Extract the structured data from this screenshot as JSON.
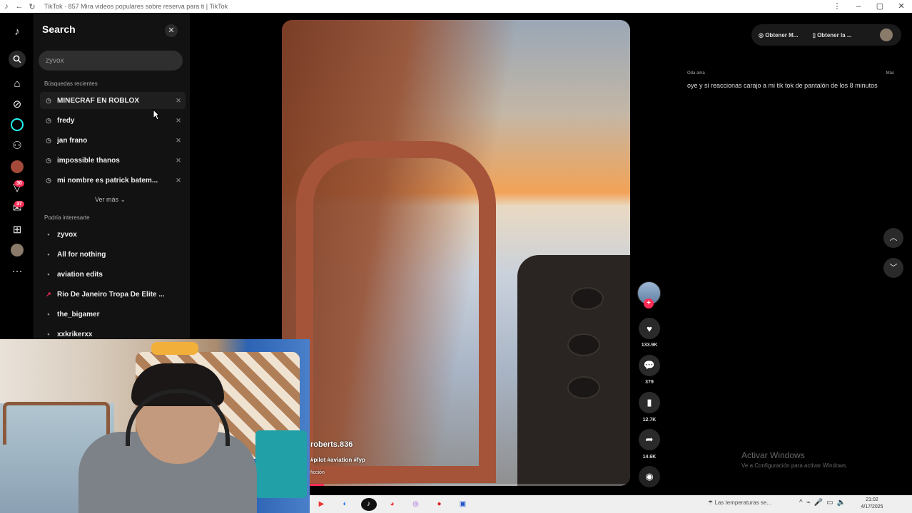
{
  "browser": {
    "tab_title": "TikTok · 857 Mira videos populares sobre reserva para ti | TikTok",
    "window_controls": [
      "⋮",
      "–",
      "▢",
      "✕"
    ]
  },
  "rail": {
    "badges": {
      "activity": "30",
      "messages": "37"
    }
  },
  "search_panel": {
    "title": "Search",
    "input_value": "",
    "input_placeholder": "zyvox",
    "recent_title": "Búsquedas recientes",
    "recent": [
      "MINECRAF EN ROBLOX",
      "fredy",
      "jan frano",
      "impossible thanos",
      "mi nombre es patrick batem..."
    ],
    "see_more": "Ver más",
    "suggested_title": "Podría interesarte",
    "suggested": [
      "zyvox",
      "All for nothing",
      "aviation edits",
      "Rio De Janeiro Tropa De Elite ...",
      "the_bigamer",
      "xxkrikerxx"
    ]
  },
  "video": {
    "author": "roberts.836",
    "hashtags": "#pilot #aviation #fyp",
    "sound": "ficción",
    "progress": 0.12
  },
  "actions": {
    "likes": "133.9K",
    "comments": "379",
    "saves": "12.7K",
    "shares": "14.6K"
  },
  "header_buttons": {
    "get_coins": "Obtener M...",
    "get_app": "Obtener la ..."
  },
  "side_comment": {
    "user": "Oda ama",
    "more": "Más",
    "text": "oye y si reaccionas carajo a mi tik tok de pantalón de los 8 minutos"
  },
  "windows": {
    "activate_title": "Activar Windows",
    "activate_sub": "Ve a Configuración para activar Windows."
  },
  "taskbar": {
    "weather": "Las temperaturas se...",
    "time": "21:02",
    "date": "4/17/2025"
  },
  "colors": {
    "accent": "#fe2c55",
    "panel": "#121212"
  }
}
